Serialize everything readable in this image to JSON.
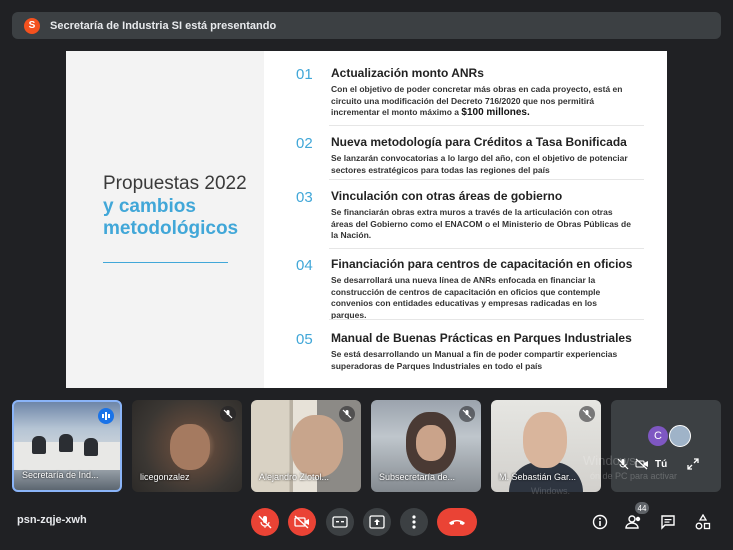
{
  "banner": {
    "avatar_letter": "S",
    "text": "Secretaría de Industria SI está presentando"
  },
  "slide": {
    "title_line1": "Propuestas 2022",
    "title_line2": "y cambios metodológicos",
    "items": [
      {
        "num": "01",
        "heading": "Actualización monto ANRs",
        "body": "Con el objetivo de poder concretar más obras en cada proyecto, está en circuito una modificación del Decreto 716/2020 que nos permitirá incrementar el monto máximo a",
        "highlight": "$100 millones."
      },
      {
        "num": "02",
        "heading": "Nueva metodología para Créditos a Tasa Bonificada",
        "body": "Se lanzarán convocatorias a lo largo del año, con el objetivo de potenciar sectores estratégicos para todas las regiones del país"
      },
      {
        "num": "03",
        "heading": "Vinculación con otras áreas de gobierno",
        "body": "Se financiarán obras extra muros a través de la articulación con otras áreas del Gobierno como el ENACOM o el Ministerio de Obras Públicas de la Nación."
      },
      {
        "num": "04",
        "heading": "Financiación para centros de capacitación en oficios",
        "body": "Se desarrollará una nueva línea de ANRs enfocada en financiar la construcción de centros de capacitación en oficios que contemple convenios con entidades educativas y empresas radicadas en los parques."
      },
      {
        "num": "05",
        "heading": "Manual de Buenas Prácticas en Parques Industriales",
        "body": "Se está desarrollando un Manual a fin de poder compartir experiencias superadoras de Parques Industriales en todo el país"
      }
    ]
  },
  "participants": [
    {
      "name": "Secretaría de Ind..."
    },
    {
      "name": "licegonzalez"
    },
    {
      "name": "Alejandro Zlotol..."
    },
    {
      "name": "Subsecretaría de..."
    },
    {
      "name": "M. Sebastián Gar..."
    }
  ],
  "self_tile": {
    "avatar_letter": "C",
    "you_label": "Tú"
  },
  "watermark": {
    "line1": "Windows",
    "line2": "ón de PC para activar",
    "line3": "Windows."
  },
  "bottom": {
    "meeting_code": "psn-zqje-xwh",
    "participant_count": "44"
  },
  "colors": {
    "accent_blue": "#41a7d8",
    "danger": "#ea4335",
    "bg": "#202124"
  }
}
